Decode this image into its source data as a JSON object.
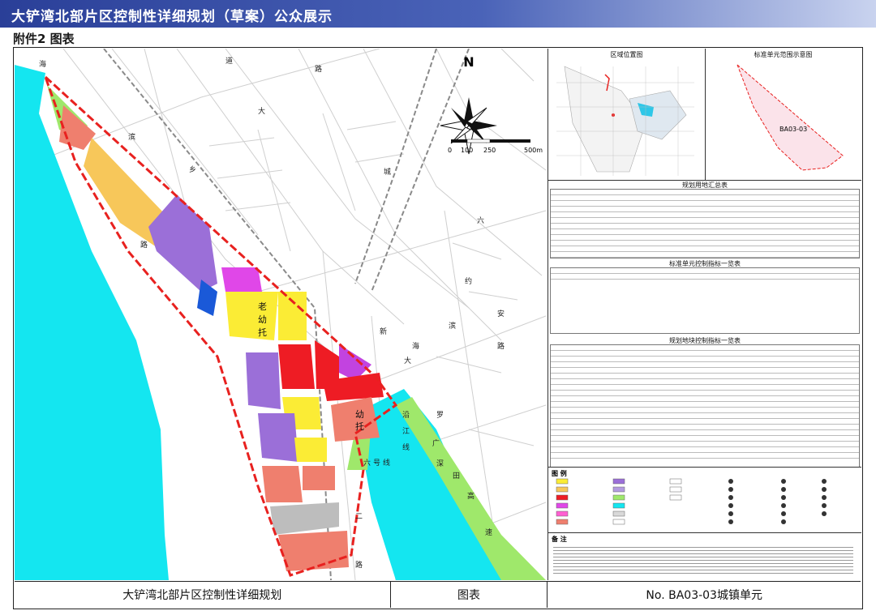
{
  "header": {
    "title": "大铲湾北部片区控制性详细规划（草案）公众展示",
    "subtitle": "附件2 图表"
  },
  "map": {
    "north_label": "N",
    "scale_labels": [
      "0",
      "100",
      "250",
      "500m"
    ],
    "road_labels": [
      "海",
      "道",
      "路",
      "大",
      "滨",
      "乡",
      "城",
      "六",
      "约",
      "安",
      "新",
      "路",
      "路",
      "滨",
      "海",
      "大",
      "罗",
      "田",
      "高",
      "速",
      "广",
      "深",
      "沿",
      "江",
      "线",
      "六",
      "号",
      "线",
      "二",
      "路"
    ],
    "land_labels": [
      "老",
      "幼",
      "托",
      "幼",
      "托"
    ],
    "colors": {
      "water": "#14e6f0",
      "residential_2": "#fbec35",
      "residential_4": "#f7c75a",
      "commercial": "#ee1c24",
      "govt": "#ff5fd2",
      "edu": "#f59a8a",
      "industrial_m": "#9b6fd8",
      "green": "#9fe86b",
      "road": "#d9d9d9",
      "boundary": "#e8211f"
    }
  },
  "panel": {
    "location_map_title": "区域位置图",
    "unit_map_title": "标准单元范围示意图",
    "unit_code": "BA03-03",
    "landuse_table_title": "规划用地汇总表",
    "unit_index_title": "标准单元控制指标一览表",
    "plot_index_title": "规划地块控制指标一览表",
    "legend_title": "图 例",
    "notes_title": "备 注"
  },
  "titlebar": {
    "project": "大铲湾北部片区控制性详细规划",
    "type": "图表",
    "unit": "No. BA03-03城镇单元"
  }
}
